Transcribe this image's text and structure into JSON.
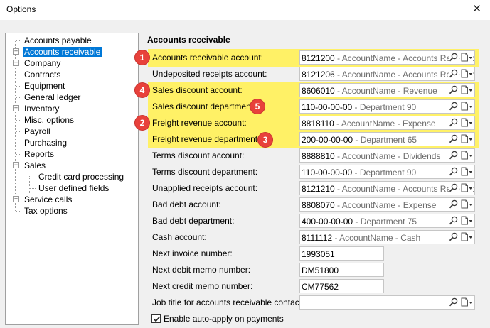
{
  "window": {
    "title": "Options",
    "close_glyph": "✕"
  },
  "tree": {
    "items": [
      {
        "label": "Accounts payable",
        "expandable": false,
        "selected": false,
        "level": 0
      },
      {
        "label": "Accounts receivable",
        "expandable": true,
        "selected": true,
        "level": 0
      },
      {
        "label": "Company",
        "expandable": true,
        "selected": false,
        "level": 0
      },
      {
        "label": "Contracts",
        "expandable": false,
        "selected": false,
        "level": 0
      },
      {
        "label": "Equipment",
        "expandable": false,
        "selected": false,
        "level": 0
      },
      {
        "label": "General ledger",
        "expandable": false,
        "selected": false,
        "level": 0
      },
      {
        "label": "Inventory",
        "expandable": true,
        "selected": false,
        "level": 0
      },
      {
        "label": "Misc. options",
        "expandable": false,
        "selected": false,
        "level": 0
      },
      {
        "label": "Payroll",
        "expandable": false,
        "selected": false,
        "level": 0
      },
      {
        "label": "Purchasing",
        "expandable": false,
        "selected": false,
        "level": 0
      },
      {
        "label": "Reports",
        "expandable": false,
        "selected": false,
        "level": 0
      },
      {
        "label": "Sales",
        "expandable": true,
        "expanded": true,
        "selected": false,
        "level": 0
      },
      {
        "label": "Credit card processing",
        "expandable": false,
        "selected": false,
        "level": 1
      },
      {
        "label": "User defined fields",
        "expandable": false,
        "selected": false,
        "level": 1
      },
      {
        "label": "Service calls",
        "expandable": true,
        "selected": false,
        "level": 0
      },
      {
        "label": "Tax options",
        "expandable": false,
        "selected": false,
        "level": 0
      }
    ]
  },
  "panel": {
    "title": "Accounts receivable",
    "fields": [
      {
        "label": "Accounts receivable account:",
        "code": "8121200",
        "desc": " - AccountName - Accounts Receivable",
        "type": "lookup"
      },
      {
        "label": "Undeposited receipts account:",
        "code": "8121206",
        "desc": " - AccountName - Accounts Receivable",
        "type": "lookup"
      },
      {
        "label": "Sales discount account:",
        "code": "8606010",
        "desc": " - AccountName - Revenue",
        "type": "lookup"
      },
      {
        "label": "Sales discount department:",
        "code": "110-00-00-00",
        "desc": " - Department 90",
        "type": "lookup"
      },
      {
        "label": "Freight revenue account:",
        "code": "8818110",
        "desc": " - AccountName - Expense",
        "type": "lookup"
      },
      {
        "label": "Freight revenue department:",
        "code": "200-00-00-00",
        "desc": " - Department 65",
        "type": "lookup"
      },
      {
        "label": "Terms discount account:",
        "code": "8888810",
        "desc": " - AccountName - Dividends",
        "type": "lookup"
      },
      {
        "label": "Terms discount department:",
        "code": "110-00-00-00",
        "desc": " - Department 90",
        "type": "lookup"
      },
      {
        "label": "Unapplied receipts account:",
        "code": "8121210",
        "desc": " - AccountName - Accounts Receivable",
        "type": "lookup"
      },
      {
        "label": "Bad debt account:",
        "code": "8808070",
        "desc": " - AccountName - Expense",
        "type": "lookup"
      },
      {
        "label": "Bad debt department:",
        "code": "400-00-00-00",
        "desc": " - Department 75",
        "type": "lookup"
      },
      {
        "label": "Cash account:",
        "code": "8111112",
        "desc": " - AccountName - Cash",
        "type": "lookup"
      },
      {
        "label": "Next invoice number:",
        "code": "1993051",
        "desc": "",
        "type": "text"
      },
      {
        "label": "Next debit memo number:",
        "code": "DM51800",
        "desc": "",
        "type": "text"
      },
      {
        "label": "Next credit memo number:",
        "code": "CM77562",
        "desc": "",
        "type": "text"
      },
      {
        "label": "Job title for accounts receivable contact:",
        "code": "",
        "desc": "",
        "type": "lookup"
      }
    ],
    "checkbox": {
      "label": "Enable auto-apply on payments",
      "checked": true
    },
    "highlight_color": "#fff166"
  },
  "callouts": [
    {
      "number": "1"
    },
    {
      "number": "4"
    },
    {
      "number": "5"
    },
    {
      "number": "2"
    },
    {
      "number": "3"
    }
  ],
  "icons": {
    "lookup": "magnifier-icon",
    "dropdown": "document-dropdown-icon"
  }
}
